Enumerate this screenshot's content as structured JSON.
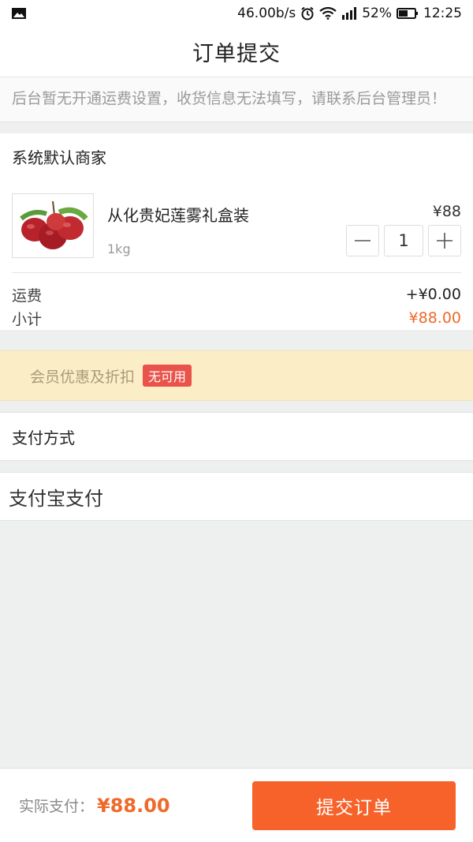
{
  "status_bar": {
    "speed": "46.00b/s",
    "battery": "52%",
    "time": "12:25"
  },
  "header": {
    "title": "订单提交"
  },
  "notice": {
    "text": "后台暂无开通运费设置，收货信息无法填写，请联系后台管理员！"
  },
  "merchant": {
    "name": "系统默认商家",
    "product": {
      "name": "从化贵妃莲雾礼盒装",
      "spec": "1kg",
      "price": "¥88",
      "quantity": "1"
    },
    "shipping_label": "运费",
    "shipping_value": "+¥0.00",
    "subtotal_label": "小计",
    "subtotal_value": "¥88.00"
  },
  "member_discount": {
    "label": "会员优惠及折扣",
    "badge": "无可用"
  },
  "payment": {
    "section_title": "支付方式",
    "method": "支付宝支付"
  },
  "footer": {
    "pay_label": "实际支付：",
    "pay_amount": "¥88.00",
    "submit_label": "提交订单"
  },
  "colors": {
    "accent": "#f6622a",
    "price_orange": "#ee6a2b",
    "badge_red": "#e9534a",
    "member_bg": "#fbeec7"
  },
  "icons": [
    "image-icon",
    "alarm-icon",
    "wifi-icon",
    "signal-icon",
    "battery-icon",
    "minus-icon",
    "plus-icon"
  ]
}
